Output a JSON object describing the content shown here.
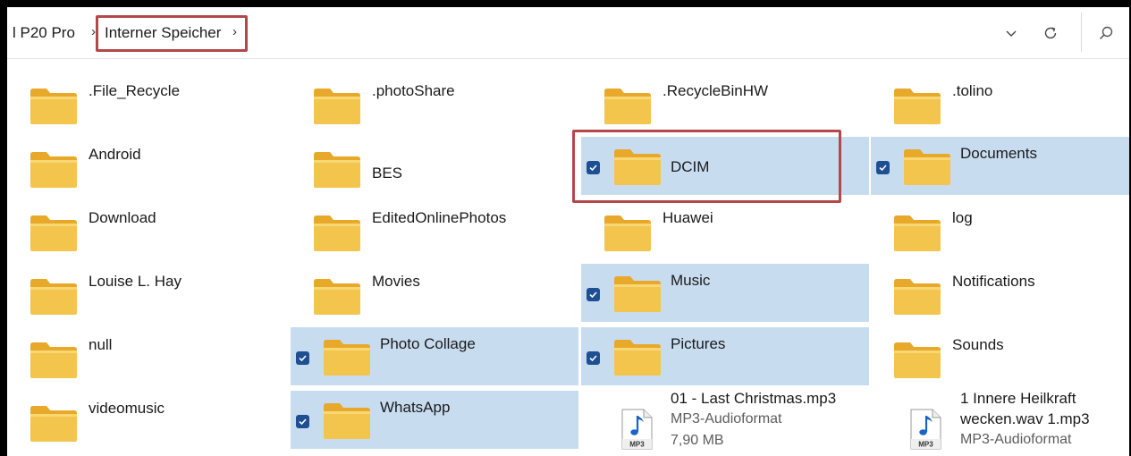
{
  "breadcrumb": {
    "device": "l P20 Pro",
    "location": "Interner Speicher"
  },
  "folders": [
    ".File_Recycle",
    ".photoShare",
    ".RecycleBinHW",
    ".tolino",
    "Android",
    "BES",
    "DCIM",
    "Documents",
    "Download",
    "EditedOnlinePhotos",
    "Huawei",
    "log",
    "Louise L. Hay",
    "Movies",
    "Music",
    "Notifications",
    "null",
    "Photo Collage",
    "Pictures",
    "Sounds",
    "videomusic",
    "WhatsApp"
  ],
  "selected": [
    "DCIM",
    "Documents",
    "Music",
    "Photo Collage",
    "Pictures",
    "WhatsApp"
  ],
  "files": [
    {
      "name": "01 - Last Christmas.mp3",
      "type": "MP3-Audioformat",
      "size": "7,90 MB",
      "badge": "MP3"
    },
    {
      "name": "1 Innere Heilkraft wecken.wav 1.mp3",
      "name_line1": "1 Innere Heilkraft",
      "name_line2": "wecken.wav 1.mp3",
      "type": "MP3-Audioformat",
      "badge": "MP3"
    }
  ],
  "colors": {
    "selection": "#c8dcf0",
    "highlight_box": "#b4474a",
    "checkbox": "#1f4f93",
    "folder": "#f3c54c"
  },
  "icons": {
    "folder": "folder-icon",
    "audio": "mp3-file-icon",
    "dropdown": "chevron-down-icon",
    "refresh": "refresh-icon",
    "search": "search-icon"
  }
}
